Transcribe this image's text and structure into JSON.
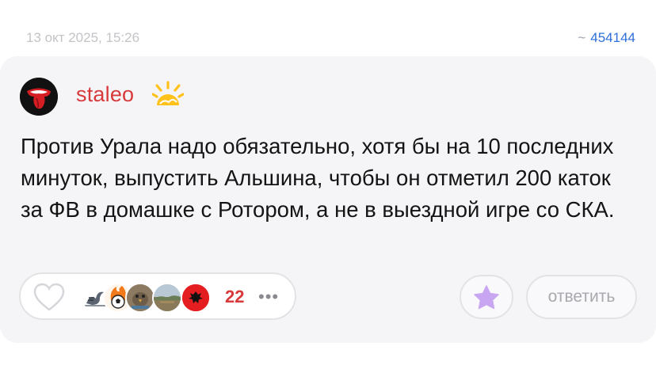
{
  "meta": {
    "timestamp": "13 окт 2025, 15:26",
    "id_prefix": "~",
    "comment_id": "454144"
  },
  "comment": {
    "username": "staleo",
    "avatar_icon": "rolling-stones-tongue-icon",
    "badge_icon": "sun-badge-icon",
    "text": "Против Урала надо обязательно, хотя бы на 10 последних минуток, выпустить Альшина, чтобы он отметил 200 каток за ФВ в домашке с Ротором, а не в выездной игре со СКА."
  },
  "reactions": {
    "like_icon": "heart-outline-icon",
    "avatars": [
      {
        "icon": "swan-avatar-icon"
      },
      {
        "icon": "soccer-ball-flame-avatar-icon"
      },
      {
        "icon": "bird-avatar-icon"
      },
      {
        "icon": "landscape-avatar-icon"
      },
      {
        "icon": "albania-flag-avatar-icon"
      }
    ],
    "count": "22",
    "more_label": "•••"
  },
  "actions": {
    "favorite_icon": "star-icon",
    "reply_label": "ответить"
  },
  "colors": {
    "username": "#d8393a",
    "count": "#d8393a",
    "link": "#2e6fd9",
    "card_bg": "#f5f5f7",
    "star": "#c9a6f2"
  }
}
